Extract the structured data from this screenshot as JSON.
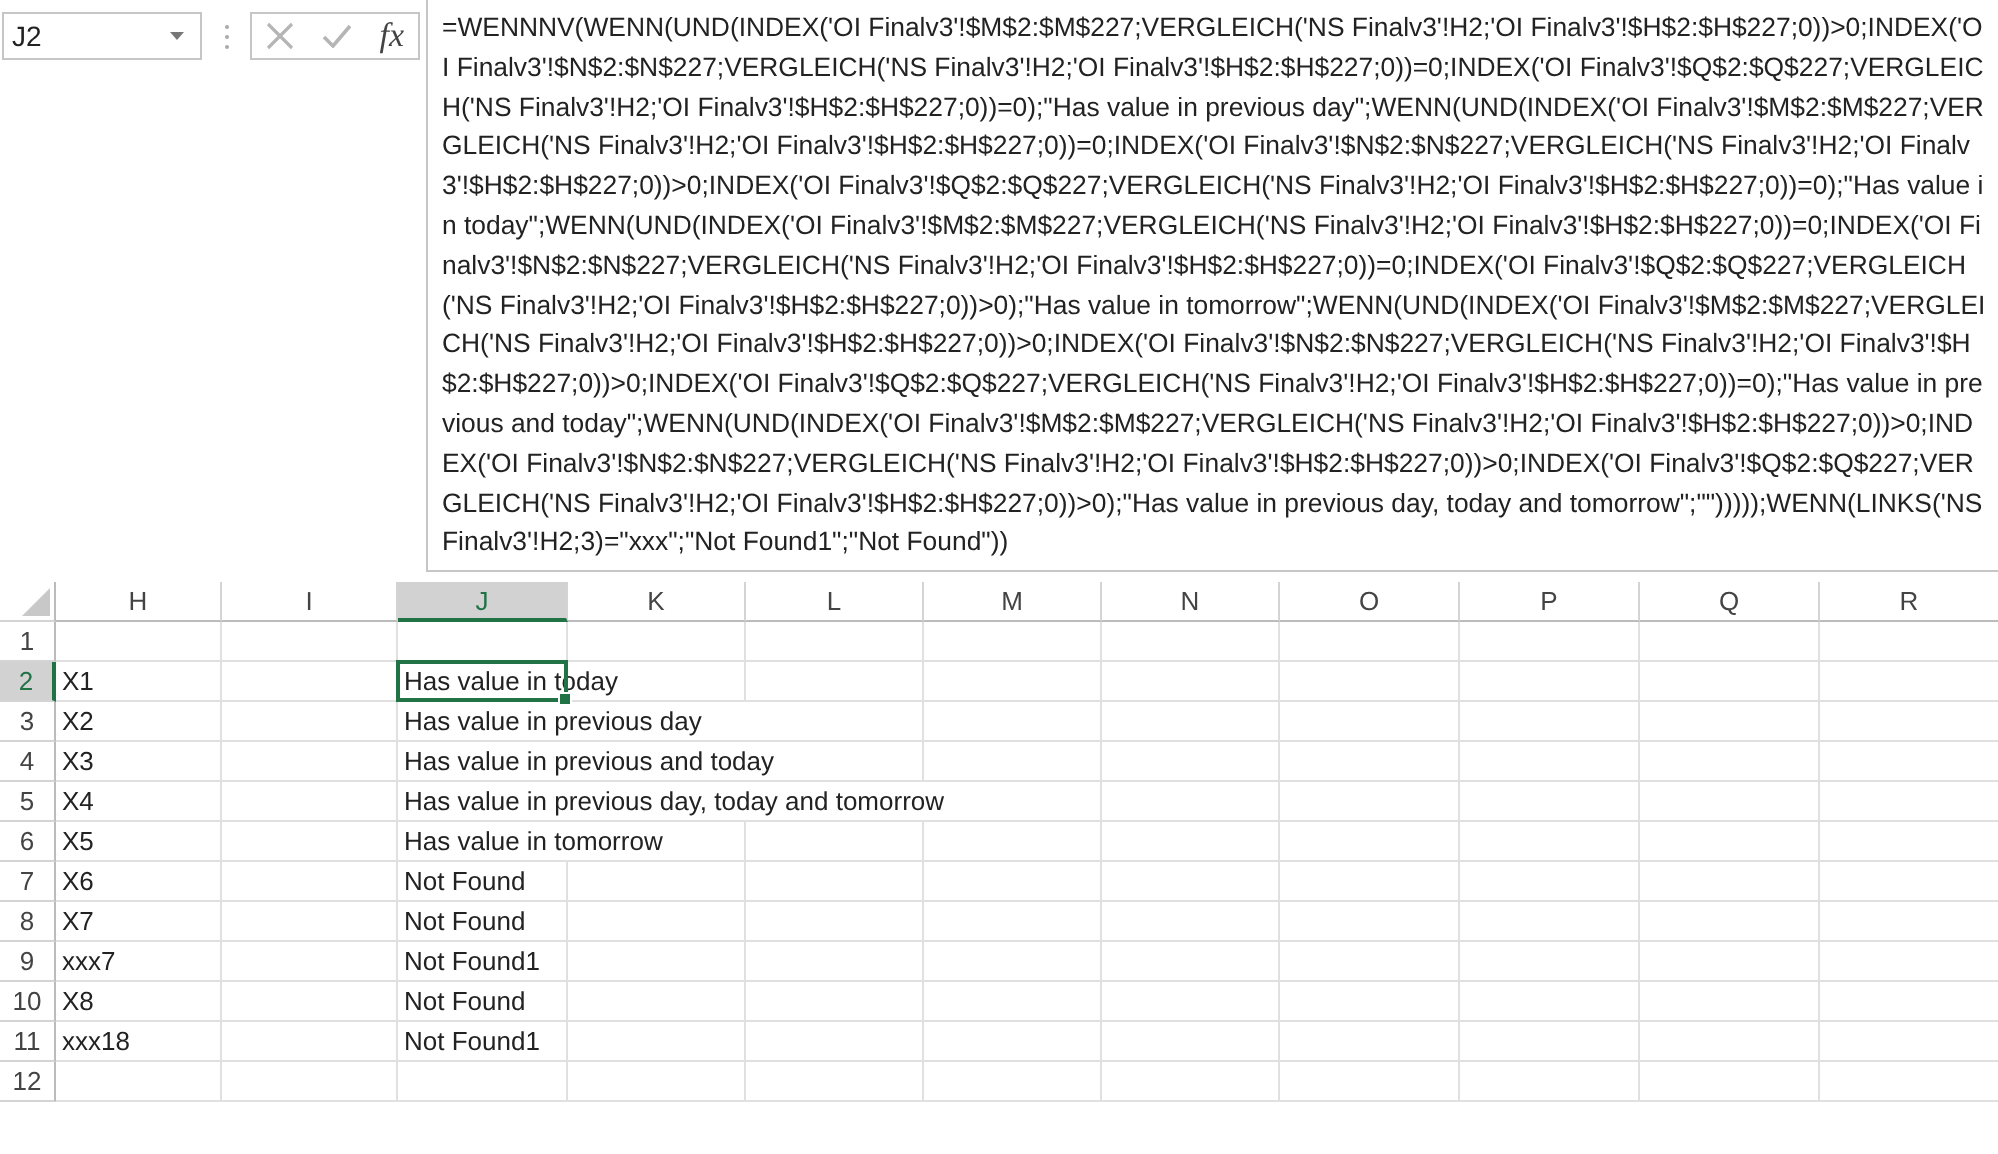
{
  "name_box": {
    "value": "J2"
  },
  "formula_buttons": {
    "function_label": "fx"
  },
  "formula": "=WENNNV(WENN(UND(INDEX('OI Finalv3'!$M$2:$M$227;VERGLEICH('NS Finalv3'!H2;'OI Finalv3'!$H$2:$H$227;0))>0;INDEX('OI Finalv3'!$N$2:$N$227;VERGLEICH('NS Finalv3'!H2;'OI Finalv3'!$H$2:$H$227;0))=0;INDEX('OI Finalv3'!$Q$2:$Q$227;VERGLEICH('NS Finalv3'!H2;'OI Finalv3'!$H$2:$H$227;0))=0);\"Has value in previous day\";WENN(UND(INDEX('OI Finalv3'!$M$2:$M$227;VERGLEICH('NS Finalv3'!H2;'OI Finalv3'!$H$2:$H$227;0))=0;INDEX('OI Finalv3'!$N$2:$N$227;VERGLEICH('NS Finalv3'!H2;'OI Finalv3'!$H$2:$H$227;0))>0;INDEX('OI Finalv3'!$Q$2:$Q$227;VERGLEICH('NS Finalv3'!H2;'OI Finalv3'!$H$2:$H$227;0))=0);\"Has value in today\";WENN(UND(INDEX('OI Finalv3'!$M$2:$M$227;VERGLEICH('NS Finalv3'!H2;'OI Finalv3'!$H$2:$H$227;0))=0;INDEX('OI Finalv3'!$N$2:$N$227;VERGLEICH('NS Finalv3'!H2;'OI Finalv3'!$H$2:$H$227;0))=0;INDEX('OI Finalv3'!$Q$2:$Q$227;VERGLEICH('NS Finalv3'!H2;'OI Finalv3'!$H$2:$H$227;0))>0);\"Has value in tomorrow\";WENN(UND(INDEX('OI Finalv3'!$M$2:$M$227;VERGLEICH('NS Finalv3'!H2;'OI Finalv3'!$H$2:$H$227;0))>0;INDEX('OI Finalv3'!$N$2:$N$227;VERGLEICH('NS Finalv3'!H2;'OI Finalv3'!$H$2:$H$227;0))>0;INDEX('OI Finalv3'!$Q$2:$Q$227;VERGLEICH('NS Finalv3'!H2;'OI Finalv3'!$H$2:$H$227;0))=0);\"Has value in previous and today\";WENN(UND(INDEX('OI Finalv3'!$M$2:$M$227;VERGLEICH('NS Finalv3'!H2;'OI Finalv3'!$H$2:$H$227;0))>0;INDEX('OI Finalv3'!$N$2:$N$227;VERGLEICH('NS Finalv3'!H2;'OI Finalv3'!$H$2:$H$227;0))>0;INDEX('OI Finalv3'!$Q$2:$Q$227;VERGLEICH('NS Finalv3'!H2;'OI Finalv3'!$H$2:$H$227;0))>0);\"Has value in previous day, today and tomorrow\";\"\")))));WENN(LINKS('NS Finalv3'!H2;3)=\"xxx\";\"Not Found1\";\"Not Found\"))",
  "columns": [
    {
      "label": "H",
      "selected": false
    },
    {
      "label": "I",
      "selected": false
    },
    {
      "label": "J",
      "selected": true
    },
    {
      "label": "K",
      "selected": false
    },
    {
      "label": "L",
      "selected": false
    },
    {
      "label": "M",
      "selected": false
    },
    {
      "label": "N",
      "selected": false
    },
    {
      "label": "O",
      "selected": false
    },
    {
      "label": "P",
      "selected": false
    },
    {
      "label": "Q",
      "selected": false
    },
    {
      "label": "R",
      "selected": false
    }
  ],
  "rows": [
    {
      "number": "1",
      "selected": false
    },
    {
      "number": "2",
      "selected": true,
      "h": "X1",
      "j": "Has value in today"
    },
    {
      "number": "3",
      "selected": false,
      "h": "X2",
      "j": "Has value in previous day"
    },
    {
      "number": "4",
      "selected": false,
      "h": "X3",
      "j": "Has value in previous and today"
    },
    {
      "number": "5",
      "selected": false,
      "h": "X4",
      "j": "Has value in previous day, today and tomorrow"
    },
    {
      "number": "6",
      "selected": false,
      "h": "X5",
      "j": "Has value in tomorrow"
    },
    {
      "number": "7",
      "selected": false,
      "h": "X6",
      "j": "Not Found"
    },
    {
      "number": "8",
      "selected": false,
      "h": "X7",
      "j": "Not Found"
    },
    {
      "number": "9",
      "selected": false,
      "h": "xxx7",
      "j": "Not Found1"
    },
    {
      "number": "10",
      "selected": false,
      "h": "X8",
      "j": "Not Found"
    },
    {
      "number": "11",
      "selected": false,
      "h": "xxx18",
      "j": "Not Found1"
    },
    {
      "number": "12",
      "selected": false
    }
  ]
}
